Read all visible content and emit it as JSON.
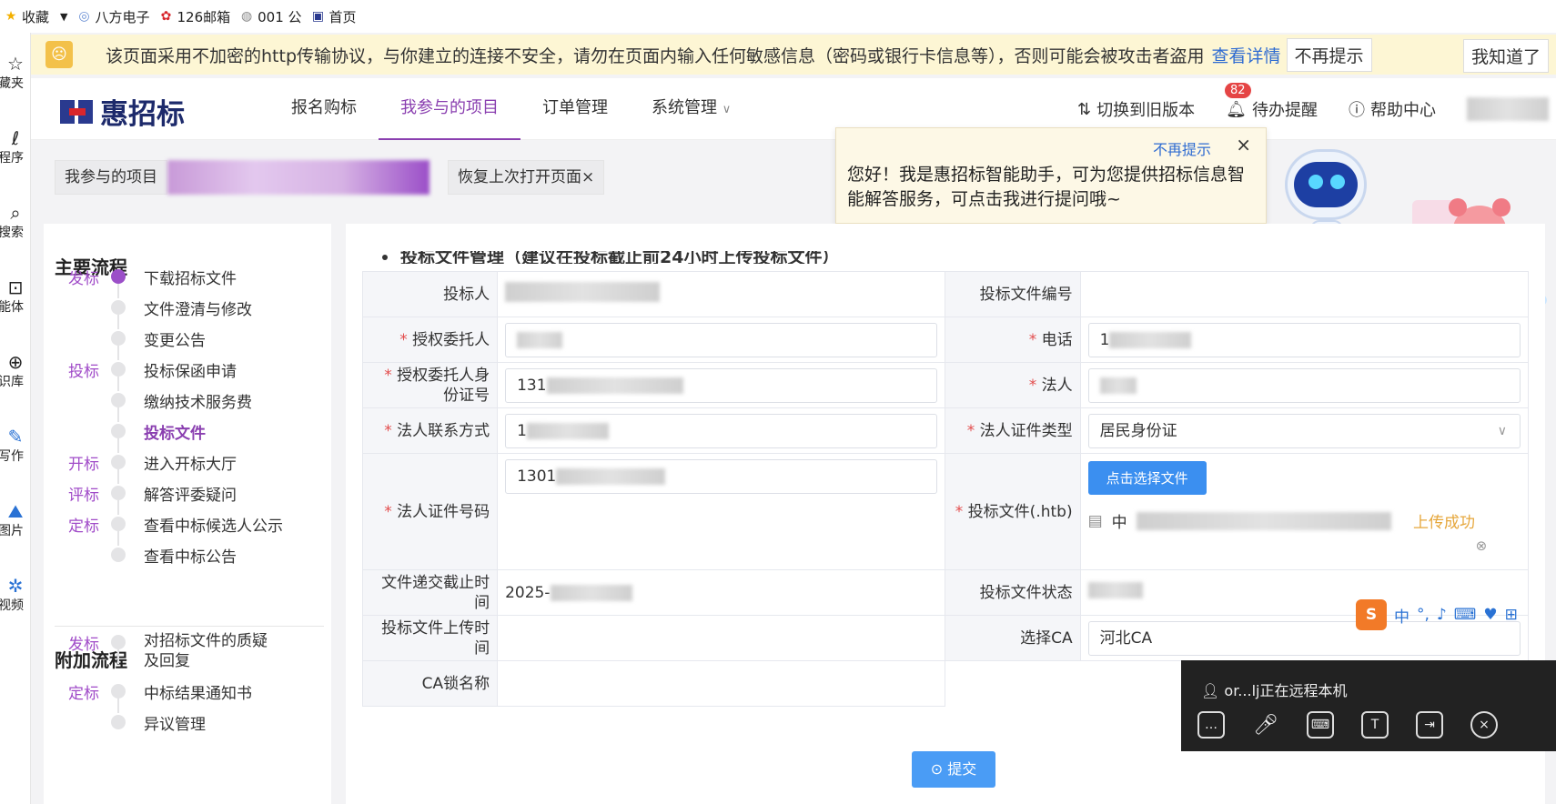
{
  "bookmarks": [
    "收藏",
    "八方电子",
    "126邮箱",
    "001 公",
    "首页"
  ],
  "sidebar": [
    "藏夹",
    "程序",
    "搜索",
    "能体",
    "识库",
    "写作",
    "图片",
    "视频"
  ],
  "warning": {
    "text": "该页面采用不加密的http传输协议，与你建立的连接不安全，请勿在页面内输入任何敏感信息（密码或银行卡信息等），否则可能会被攻击者盗用",
    "detail": "查看详情",
    "no_remind": "不再提示",
    "got_it": "我知道了"
  },
  "header": {
    "logo": "惠招标",
    "nav": [
      "报名购标",
      "我参与的项目",
      "订单管理",
      "系统管理"
    ],
    "switch_old": "切换到旧版本",
    "todo": "待办提醒",
    "todo_count": "82",
    "help": "帮助中心"
  },
  "tabs": {
    "current": "我参与的项目",
    "restore": "恢复上次打开页面"
  },
  "assistant": {
    "no_remind": "不再提示",
    "close": "×",
    "message": "您好！我是惠招标智能助手，可为您提供招标信息智能解答服务，可点击我进行提问哦~"
  },
  "process": {
    "main_title": "主要流程",
    "main_steps": [
      {
        "stage": "发标",
        "label": "下载招标文件",
        "active_dot": true
      },
      {
        "stage": "",
        "label": "文件澄清与修改"
      },
      {
        "stage": "",
        "label": "变更公告"
      },
      {
        "stage": "投标",
        "label": "投标保函申请"
      },
      {
        "stage": "",
        "label": "缴纳技术服务费"
      },
      {
        "stage": "",
        "label": "投标文件",
        "current": true
      },
      {
        "stage": "开标",
        "label": "进入开标大厅"
      },
      {
        "stage": "评标",
        "label": "解答评委疑问"
      },
      {
        "stage": "定标",
        "label": "查看中标候选人公示"
      },
      {
        "stage": "",
        "label": "查看中标公告"
      }
    ],
    "extra_title": "附加流程",
    "extra_steps": [
      {
        "stage": "发标",
        "label": "对招标文件的质疑及回复"
      },
      {
        "stage": "定标",
        "label": "中标结果通知书"
      },
      {
        "stage": "",
        "label": "异议管理"
      }
    ]
  },
  "form": {
    "section_title": "投标文件管理（建议在投标截止前24小时上传投标文件）",
    "bidder_label": "投标人",
    "file_no_label": "投标文件编号",
    "agent_label": "授权委托人",
    "phone_label": "电话",
    "phone_value": "1",
    "agent_id_label": "授权委托人身份证号",
    "agent_id_value": "131",
    "legal_label": "法人",
    "legal_contact_label": "法人联系方式",
    "legal_contact_value": "1",
    "legal_cert_type_label": "法人证件类型",
    "legal_cert_type_value": "居民身份证",
    "legal_cert_no_label": "法人证件号码",
    "legal_cert_no_value": "1301",
    "bid_file_label": "投标文件(.htb)",
    "pick_file": "点击选择文件",
    "file_name": "中",
    "upload_status": "上传成功",
    "deadline_label": "文件递交截止时间",
    "deadline_value": "2025-",
    "bid_status_label": "投标文件状态",
    "upload_time_label": "投标文件上传时间",
    "ca_label": "选择CA",
    "ca_value": "河北CA",
    "ca_lock_label": "CA锁名称",
    "submit": "提交"
  },
  "ime": [
    "中",
    "°,"
  ],
  "remote": {
    "status": "or...lj正在远程本机"
  },
  "colors": {
    "accent": "#8a3fb0",
    "primary": "#3b8ff0",
    "required": "#e34d4d",
    "warning_bg": "#fdf6d4"
  }
}
